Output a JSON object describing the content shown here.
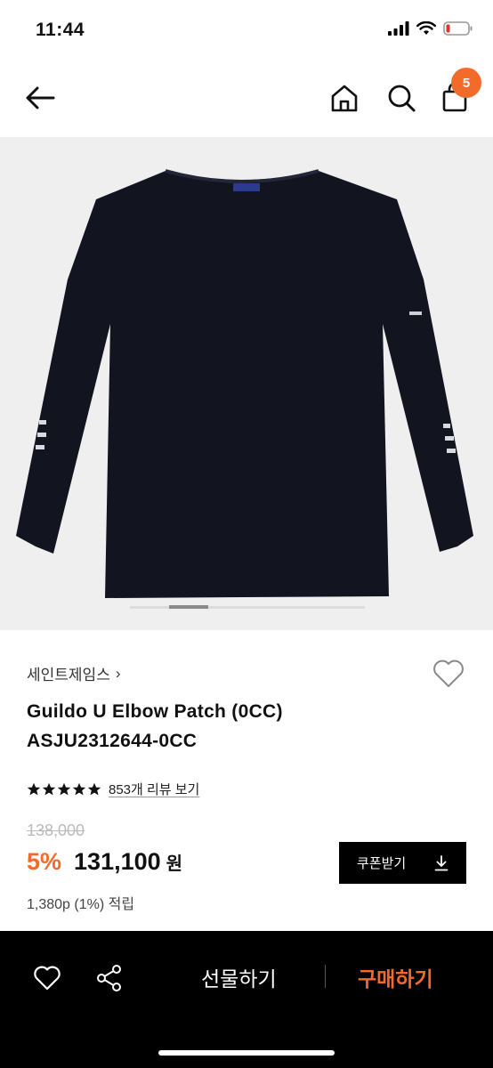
{
  "status": {
    "time": "11:44"
  },
  "nav": {
    "cart_count": "5"
  },
  "product": {
    "brand": "세인트제임스",
    "brand_chevron": "›",
    "name": "Guildo U Elbow Patch (0CC)",
    "code": "ASJU2312644-0CC",
    "rating_stars": 5,
    "review_link": "853개 리뷰 보기",
    "original_price": "138,000",
    "discount": "5%",
    "sale_price": "131,100",
    "currency": "원",
    "points": "1,380p (1%) 적립",
    "image_index": 2,
    "image_count": 6
  },
  "coupon": {
    "label": "쿠폰받기"
  },
  "bottom": {
    "gift_label": "선물하기",
    "buy_label": "구매하기"
  },
  "colors": {
    "accent": "#f36b2b",
    "garment": "#12141f",
    "background_image": "#efefef"
  }
}
